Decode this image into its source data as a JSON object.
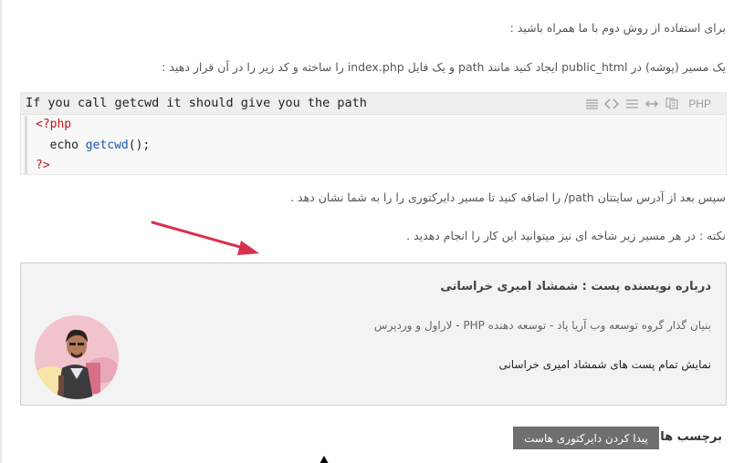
{
  "content": {
    "para1": "برای استفاده از روش دوم با ما همراه باشید :",
    "para2": "یک مسیر (پوشه) در public_html ایجاد کنید مانند path و یک فایل index.php را ساخته و کد زیر را در آن قرار دهید :",
    "para3": "سپس بعد از آدرس سایتتان path/ را اضافه کنید تا مسیر دایرکتوری را را به شما نشان دهد .",
    "para4": "نکته : در هر مسیر زیر شاخه ای نیز میتوانید این کار را انجام دهدید ."
  },
  "code": {
    "title": "If you call getcwd it should give you the path",
    "language": "PHP",
    "tools": [
      "lines-icon",
      "code-icon",
      "wrap-icon",
      "expand-icon",
      "copy-icon"
    ],
    "line1": "<?php",
    "line2_kw": "echo",
    "line2_fn": "getcwd",
    "line2_rest": "();",
    "line3": "?>"
  },
  "author": {
    "title": "درباره نویسنده پست : شمشاد امیری خراسانی",
    "description": "بنیان گذار گروه توسعه وب آریا پاد - توسعه دهنده PHP - لاراول و وردپرس",
    "link": "نمایش تمام پست های شمشاد امیری خراسانی"
  },
  "tags": {
    "label": "برچسب ها:",
    "items": [
      "پیدا کردن دایرکتوری هاست"
    ]
  },
  "colors": {
    "arrow": "#d9304e",
    "php_tag": "#c01818",
    "function": "#1b55b5",
    "tag_bg": "#6f6f6f"
  }
}
